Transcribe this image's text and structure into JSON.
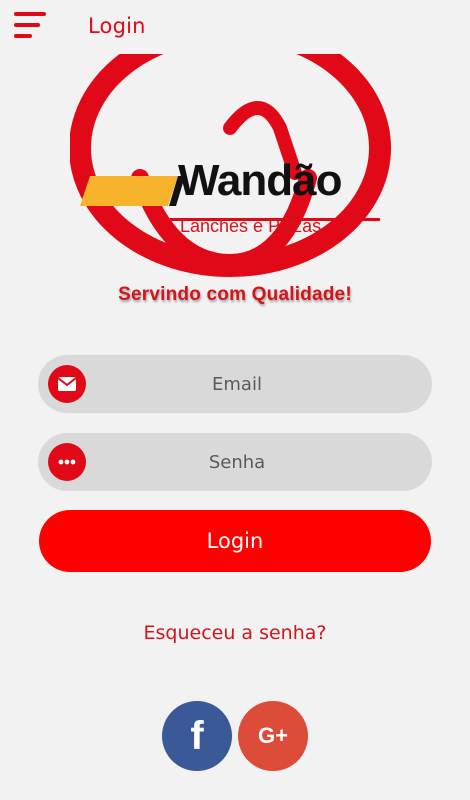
{
  "header": {
    "title": "Login",
    "menu_icon": "hamburger-menu-icon"
  },
  "logo": {
    "brand": "Wandão",
    "subtitle": "Lanches e Pizzas",
    "slogan": "Servindo com Qualidade!",
    "colors": {
      "red": "#e10918",
      "yellow": "#f7b32b",
      "black": "#111111"
    }
  },
  "form": {
    "email": {
      "placeholder": "Email",
      "value": "",
      "icon": "envelope-icon"
    },
    "password": {
      "placeholder": "Senha",
      "value": "",
      "icon": "dots-icon"
    },
    "login_label": "Login",
    "forgot_label": "Esqueceu a senha?"
  },
  "social": {
    "facebook": {
      "glyph": "f",
      "icon": "facebook-icon",
      "color": "#3b5998"
    },
    "google": {
      "glyph": "G+",
      "icon": "google-plus-icon",
      "color": "#dd4b39"
    }
  },
  "theme": {
    "accent": "#e10918",
    "button": "#ff0000",
    "field_bg": "#d9d9d9",
    "page_bg": "#f2f2f2"
  }
}
